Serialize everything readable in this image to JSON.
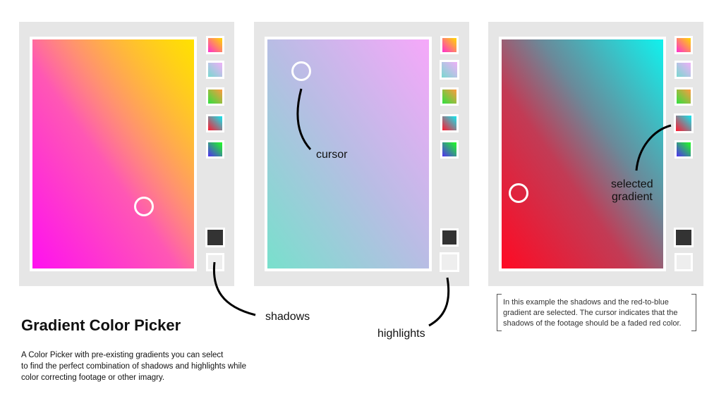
{
  "labels": {
    "cursor": "cursor",
    "shadows": "shadows",
    "highlights": "highlights",
    "selected_gradient_line1": "selected",
    "selected_gradient_line2": "gradient"
  },
  "title": "Gradient Color Picker",
  "description": [
    "A Color Picker with pre-existing gradients you can select",
    "to find the perfect combination of shadows and highlights while",
    "color correcting footage or other imagry."
  ],
  "note": [
    "In this example the shadows and the red-to-blue",
    "gradient are selected. The cursor indicates that the",
    "shadows of the footage should be a faded red color."
  ],
  "colors": {
    "panel_background": "#e6e6e6",
    "border": "#ffffff",
    "shadow_swatch": "#333333",
    "highlight_swatch": "#eeeeee"
  },
  "swatch_icons": [
    "gradient-yellow-magenta",
    "gradient-pink-teal",
    "gradient-orange-green",
    "gradient-cyan-red",
    "gradient-green-blue",
    "shadows-swatch",
    "highlights-swatch"
  ]
}
